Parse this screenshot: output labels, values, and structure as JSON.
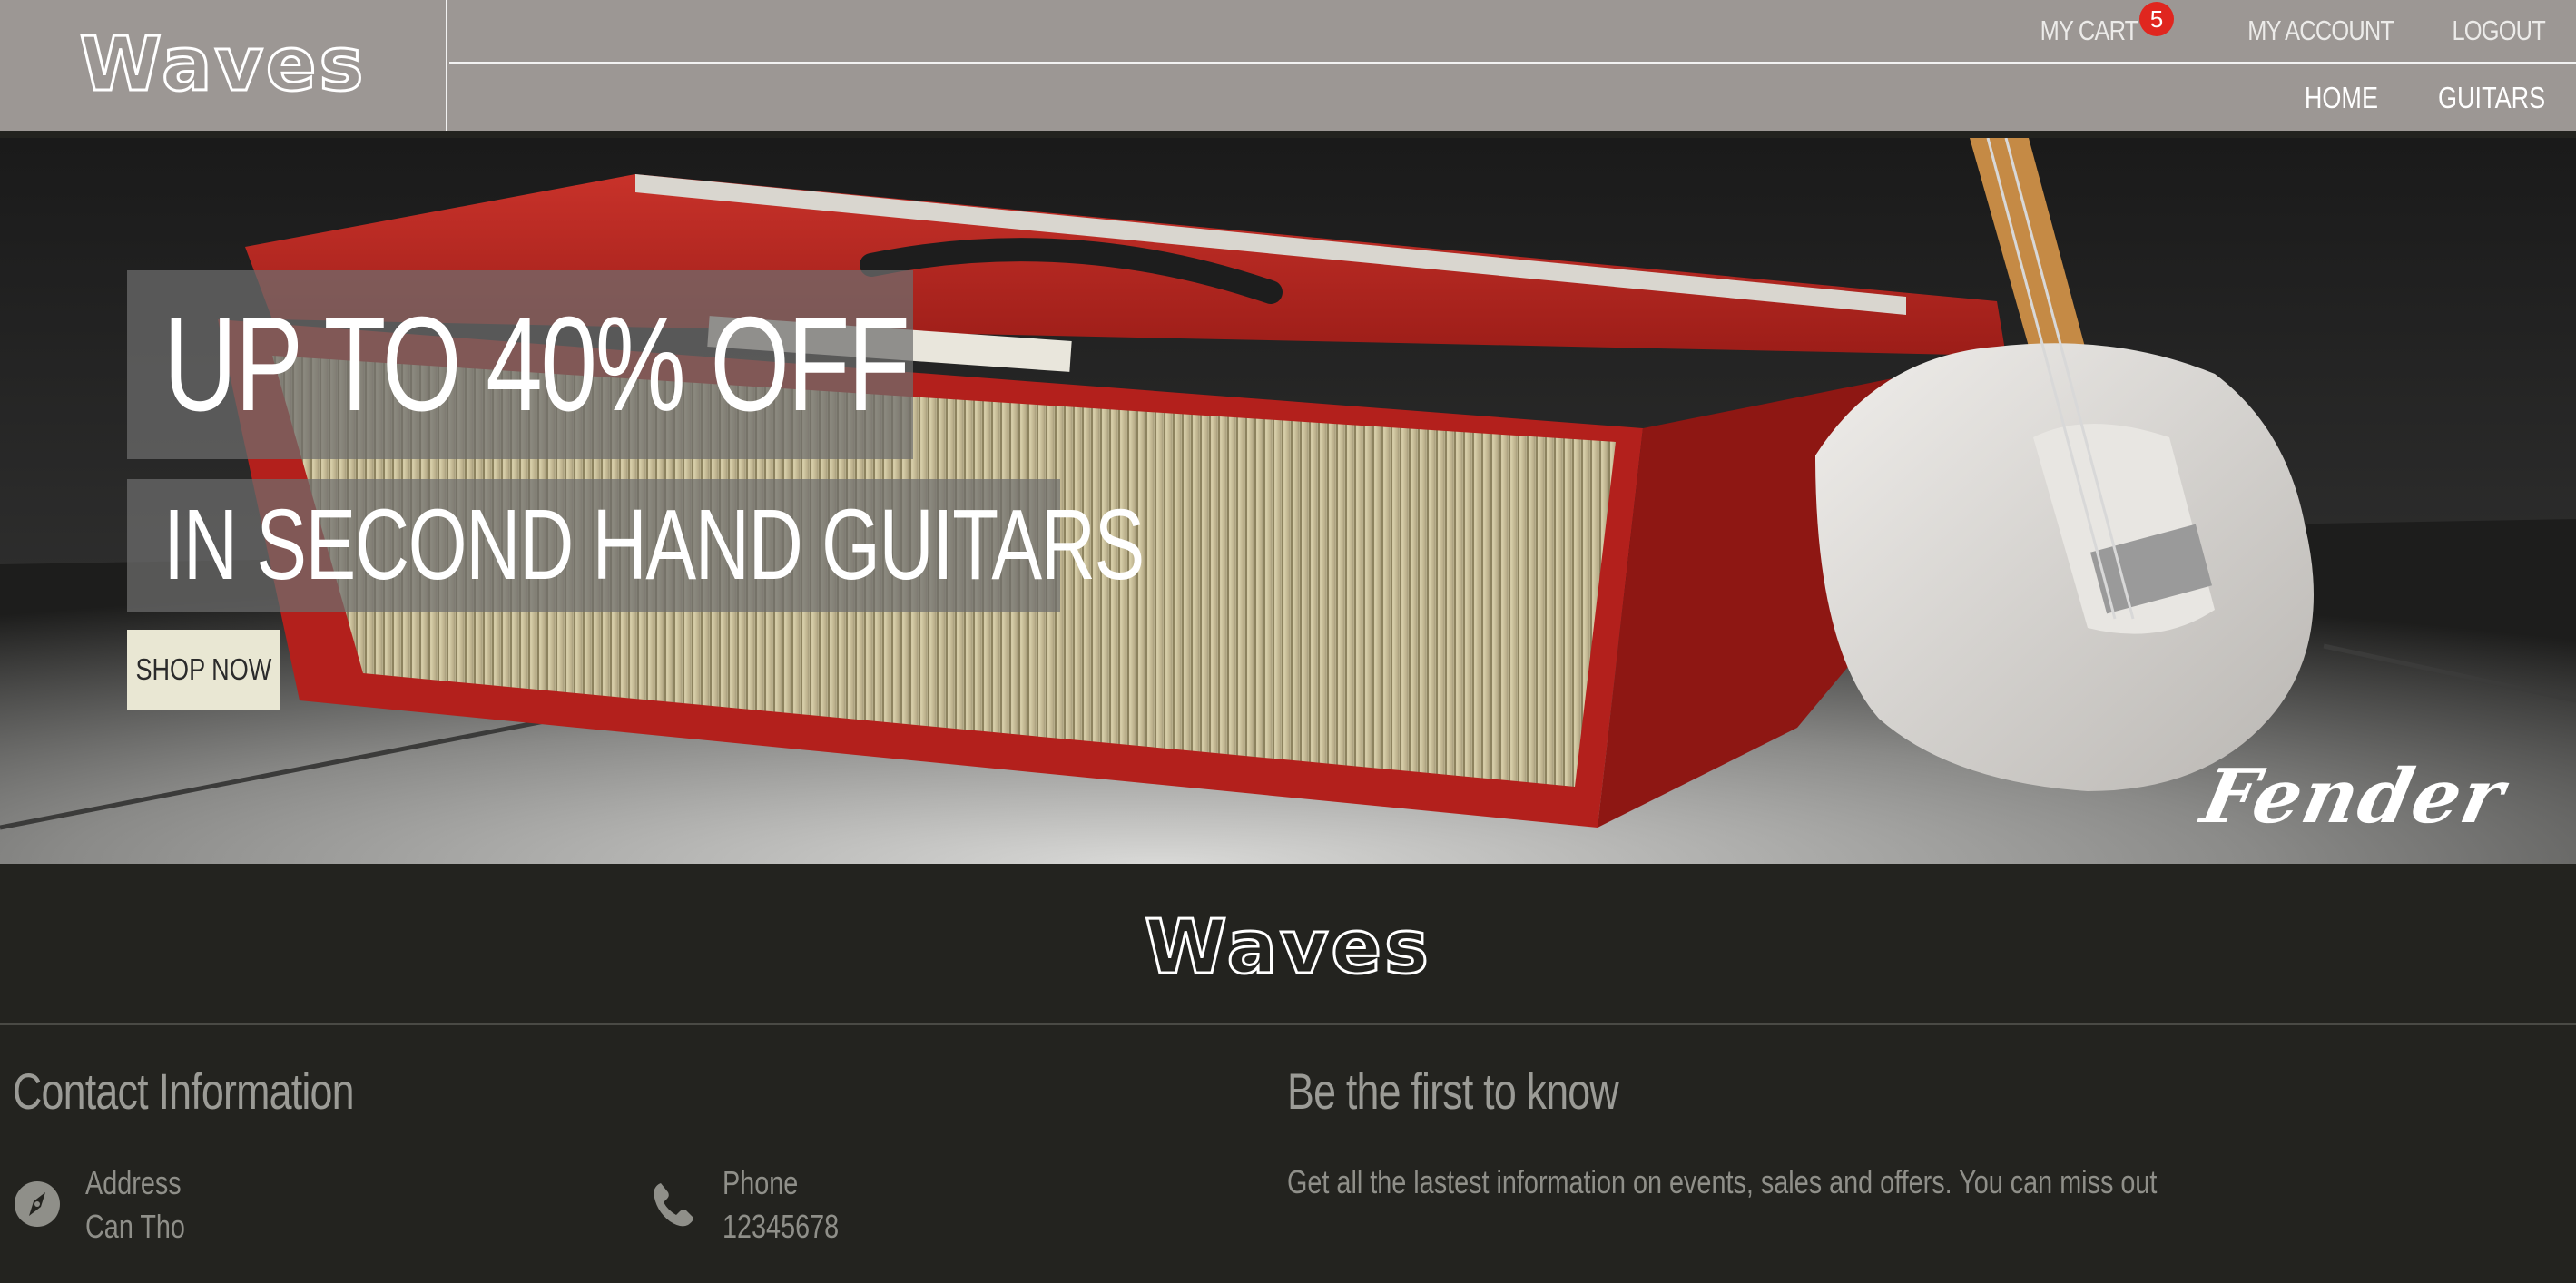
{
  "header": {
    "logo": "Waves",
    "top_links": {
      "cart_label": "MY CART",
      "cart_count": "5",
      "account_label": "MY ACCOUNT",
      "logout_label": "LOGOUT"
    },
    "nav": {
      "home": "HOME",
      "guitars": "GUITARS"
    }
  },
  "hero": {
    "headline": "UP TO 40% OFF",
    "subheadline": "IN SECOND HAND GUITARS",
    "cta_label": "SHOP NOW",
    "brand_mark": "Fender"
  },
  "footer": {
    "logo": "Waves",
    "contact_title": "Contact Information",
    "address_label": "Address",
    "address_value": "Can Tho",
    "phone_label": "Phone",
    "phone_value": "12345678",
    "newsletter_title": "Be the first to know",
    "newsletter_text": "Get all the lastest information on events, sales and offers. You can miss out"
  },
  "colors": {
    "header_bg": "#9c9794",
    "footer_bg": "#23231f",
    "badge": "#e0261f",
    "cta_bg": "#e9e7d3",
    "amp_red": "#b3201c"
  }
}
